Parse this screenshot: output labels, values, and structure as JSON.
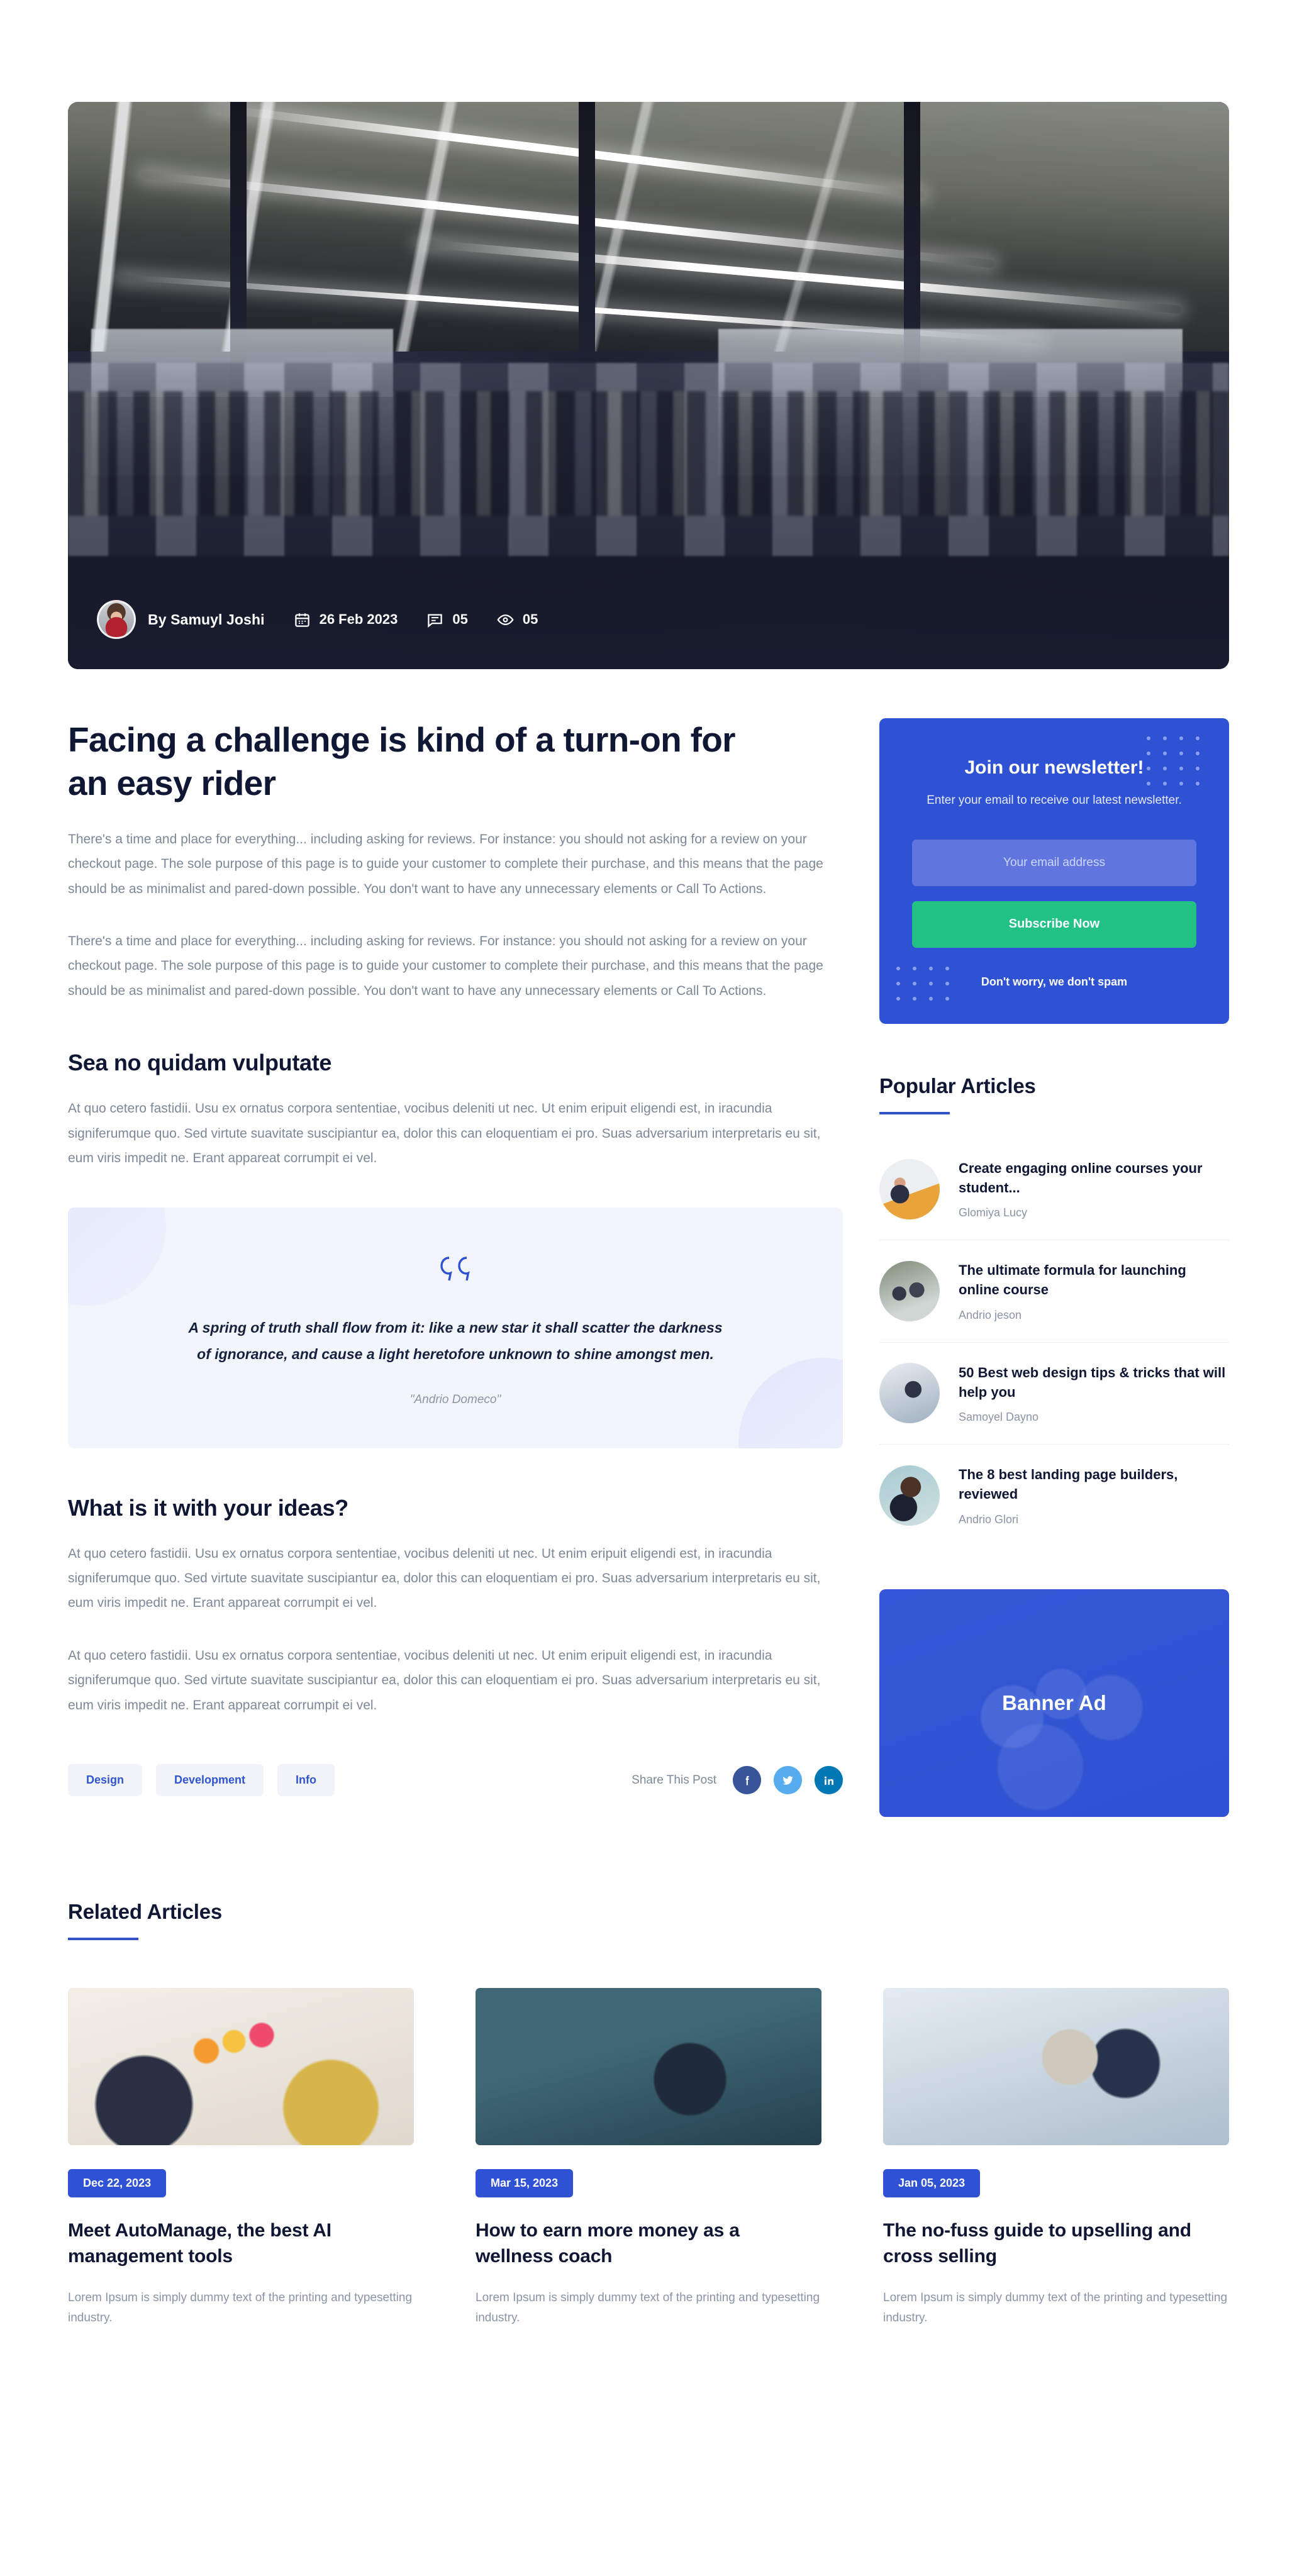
{
  "hero": {
    "image_alt": "open-plan office with rows of desks and linear ceiling lights",
    "author_prefix": "By",
    "author": "Samuyl Joshi",
    "date": "26 Feb 2023",
    "comments": "05",
    "views": "05",
    "icons": {
      "avatar": "author-avatar",
      "calendar": "calendar-icon",
      "comment": "comment-icon",
      "eye": "eye-icon"
    }
  },
  "article": {
    "title": "Facing a challenge is kind of a turn-on for an easy rider",
    "lead_1": "There's a time and place for everything... including asking for reviews. For instance: you should not asking for a review on your checkout page. The sole purpose of this page is to guide your customer to complete their purchase, and this means that the page should be as minimalist and pared-down possible. You don't want to have any unnecessary elements or Call To Actions.",
    "lead_2": "There's a time and place for everything... including asking for reviews. For instance: you should not asking for a review on your checkout page. The sole purpose of this page is to guide your customer to complete their purchase, and this means that the page should be as minimalist and pared-down possible. You don't want to have any unnecessary elements or Call To Actions.",
    "heading_1": "Sea no quidam vulputate",
    "para_1": "At quo cetero fastidii. Usu ex ornatus corpora sententiae, vocibus deleniti ut nec. Ut enim eripuit eligendi est, in iracundia signiferumque quo. Sed virtute suavitate suscipiantur ea, dolor this can eloquentiam ei pro. Suas adversarium interpretaris eu sit, eum viris impedit ne. Erant appareat corrumpit ei vel.",
    "quote": {
      "icon": "quote-icon",
      "text": "A spring of truth shall flow from it: like a new star it shall scatter the darkness of ignorance, and cause a light heretofore unknown to shine amongst men.",
      "author": "\"Andrio Domeco\""
    },
    "heading_2": "What is it with your ideas?",
    "para_2": "At quo cetero fastidii. Usu ex ornatus corpora sententiae, vocibus deleniti ut nec. Ut enim eripuit eligendi est, in iracundia signiferumque quo. Sed virtute suavitate suscipiantur ea, dolor this can eloquentiam ei pro. Suas adversarium interpretaris eu sit, eum viris impedit ne. Erant appareat corrumpit ei vel.",
    "para_3": "At quo cetero fastidii. Usu ex ornatus corpora sententiae, vocibus deleniti ut nec. Ut enim eripuit eligendi est, in iracundia signiferumque quo. Sed virtute suavitate suscipiantur ea, dolor this can eloquentiam ei pro. Suas adversarium interpretaris eu sit, eum viris impedit ne. Erant appareat corrumpit ei vel."
  },
  "tags": [
    {
      "label": "Design"
    },
    {
      "label": "Development"
    },
    {
      "label": "Info"
    }
  ],
  "share": {
    "label": "Share This Post",
    "networks": [
      {
        "name": "facebook",
        "glyph": "f",
        "color": "#395599"
      },
      {
        "name": "twitter",
        "glyph": "🐦",
        "color": "#56acee"
      },
      {
        "name": "linkedin",
        "glyph": "in",
        "color": "#0277b5"
      }
    ]
  },
  "newsletter": {
    "title": "Join our newsletter!",
    "subtitle": "Enter your email to receive our latest newsletter.",
    "placeholder": "Your email address",
    "button": "Subscribe Now",
    "note": "Don't worry, we don't spam",
    "bg_color": "#2f52d4",
    "button_color": "#22c186"
  },
  "popular": {
    "heading": "Popular Articles",
    "items": [
      {
        "title": "Create engaging online courses your student...",
        "author": "Glomiya Lucy",
        "thumb": "pt1"
      },
      {
        "title": "The ultimate formula for launching online course",
        "author": "Andrio jeson",
        "thumb": "pt2"
      },
      {
        "title": "50 Best web design tips & tricks that will help you",
        "author": "Samoyel Dayno",
        "thumb": "pt3"
      },
      {
        "title": "The 8 best landing page builders, reviewed",
        "author": "Andrio Glori",
        "thumb": "pt4"
      }
    ]
  },
  "banner_ad": {
    "label": "Banner Ad",
    "color": "#2f52d4"
  },
  "related": {
    "heading": "Related Articles",
    "cards": [
      {
        "date": "Dec 22, 2023",
        "title": "Meet AutoManage, the best AI management tools",
        "desc": "Lorem Ipsum is simply dummy text of the printing and typesetting industry.",
        "img": "ri1"
      },
      {
        "date": "Mar 15, 2023",
        "title": "How to earn more money as a wellness coach",
        "desc": "Lorem Ipsum is simply dummy text of the printing and typesetting industry.",
        "img": "ri2"
      },
      {
        "date": "Jan 05, 2023",
        "title": "The no-fuss guide to upselling and cross selling",
        "desc": "Lorem Ipsum is simply dummy text of the printing and typesetting industry.",
        "img": "ri3"
      }
    ]
  }
}
